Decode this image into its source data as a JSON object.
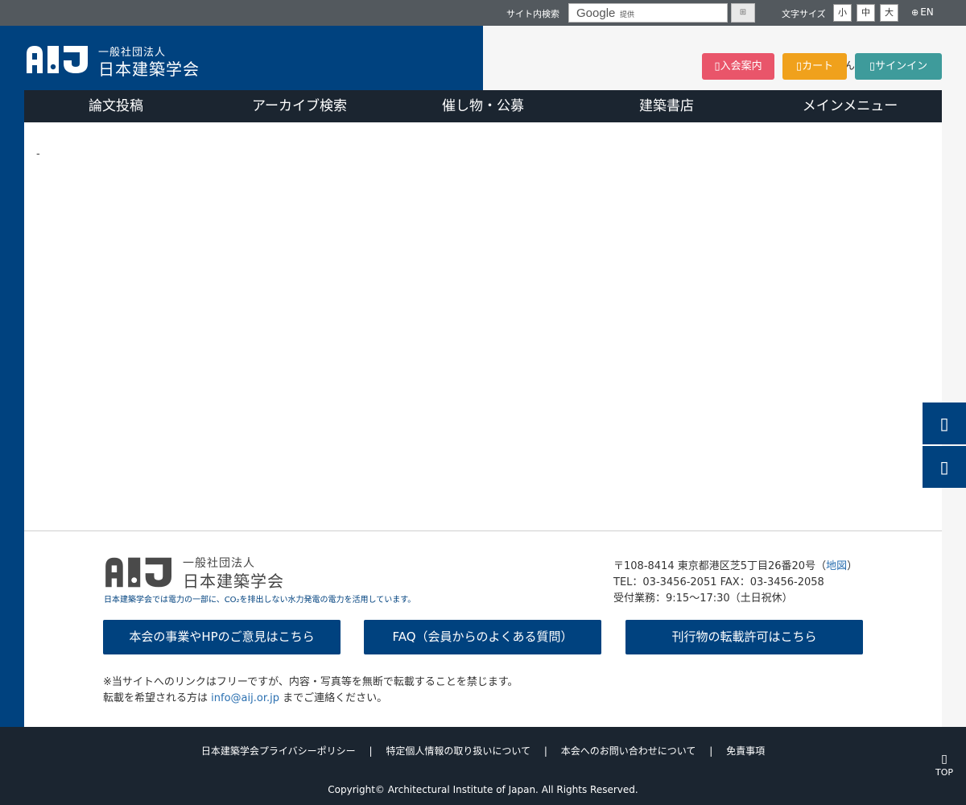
{
  "topbar": {
    "search_label": "サイト内検索",
    "search_logo": "Google",
    "search_provider": "提供",
    "search_button": "⊞",
    "font_size_label": "文字サイズ",
    "font_sizes": [
      "小",
      "中",
      "大"
    ],
    "lang_icon": "globe-icon",
    "lang_label": "EN"
  },
  "header": {
    "logo_small": "一般社団法人",
    "logo_big": "日本建築学会",
    "greeting": "こんにちは ゲストさん",
    "buttons": {
      "join": "入会案内",
      "cart": "カート",
      "signin": "サインイン"
    }
  },
  "nav": {
    "items": [
      "論文投稿",
      "アーカイブ検索",
      "催し物・公募",
      "建築書店",
      "メインメニュー"
    ]
  },
  "main": {
    "content": "-"
  },
  "footer": {
    "logo_small": "一般社団法人",
    "logo_big": "日本建築学会",
    "note": "日本建築学会では電力の一部に、CO₂を排出しない水力発電の電力を活用しています。",
    "address_line": "〒108-8414 東京都港区芝5丁目26番20号",
    "map_link": "地図",
    "tel_line": "TEL：03-3456-2051 FAX：03-3456-2058",
    "hours_line": "受付業務：9:15〜17:30（土日祝休）",
    "buttons": [
      "本会の事業やHPのご意見はこちら",
      "FAQ（会員からのよくある質問）",
      "刊行物の転載許可はこちら"
    ],
    "notice_line1": "※当サイトへのリンクはフリーですが、内容・写真等を無断で転載することを禁じます。",
    "notice_line2_prefix": "転載を希望される方は",
    "notice_email": "info@aij.or.jp",
    "notice_line2_suffix": "までご連絡ください。"
  },
  "bottom": {
    "links": [
      "日本建築学会プライバシーポリシー",
      "特定個人情報の取り扱いについて",
      "本会へのお問い合わせについて",
      "免責事項"
    ],
    "separator": "|",
    "copyright": "Copyright© Architectural Institute of Japan. All Rights Reserved.",
    "top_label": "TOP"
  },
  "colors": {
    "brand_blue": "#00427f",
    "nav_dark": "#1b2530",
    "join_red": "#e9556a",
    "cart_orange": "#f0a11c",
    "signin_teal": "#3e9b9b"
  }
}
